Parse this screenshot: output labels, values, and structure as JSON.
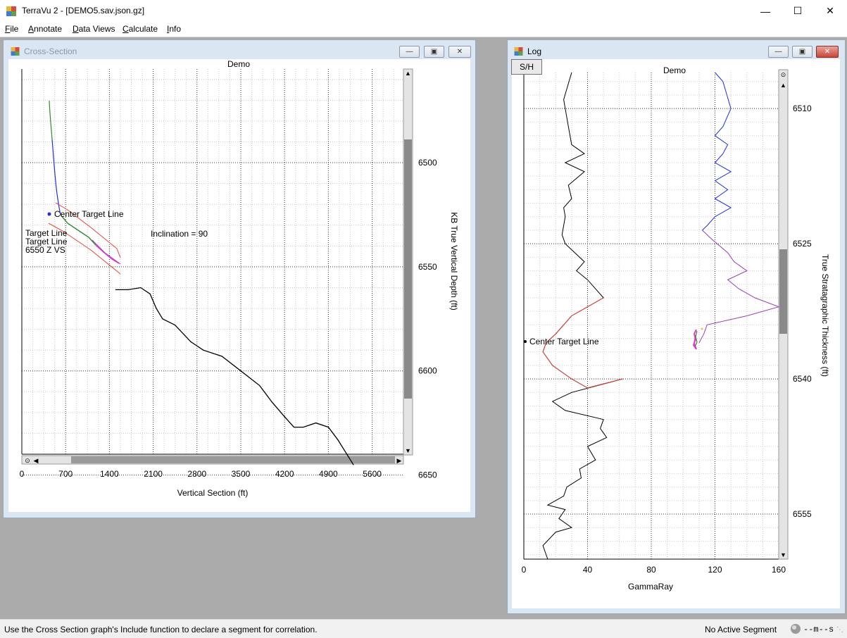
{
  "app": {
    "title": "TerraVu 2 - [DEMO5.sav.json.gz]",
    "window_controls": {
      "minimize": "—",
      "maximize": "☐",
      "close": "✕"
    }
  },
  "menu": {
    "items": [
      {
        "label": "File",
        "accel": "F"
      },
      {
        "label": "Annotate",
        "accel": "A"
      },
      {
        "label": "Data Views",
        "accel": "D"
      },
      {
        "label": "Calculate",
        "accel": "C"
      },
      {
        "label": "Info",
        "accel": "I"
      }
    ]
  },
  "cross_section": {
    "window_title": "Cross-Section",
    "chart_title": "Demo",
    "xlabel": "Vertical Section (ft)",
    "ylabel": "KB True Vertical Depth (ft)",
    "x_ticks": [
      "0",
      "700",
      "1400",
      "2100",
      "2800",
      "3500",
      "4200",
      "4900",
      "5600"
    ],
    "y_ticks": [
      "6500",
      "6550",
      "6600",
      "6650"
    ],
    "annotations": {
      "center_target": "Center Target Line",
      "target_line_1": "Target Line",
      "target_line_2": "Target Line",
      "zvs": "6550 Z VS",
      "inclination": "Inclination = 90"
    }
  },
  "log": {
    "window_title": "Log",
    "sh_button": "S/H",
    "chart_title": "Demo",
    "xlabel": "GammaRay",
    "ylabel": "True Stratagraphic Thickness (ft)",
    "x_ticks": [
      "0",
      "40",
      "80",
      "120",
      "160"
    ],
    "y_ticks": [
      "6510",
      "6525",
      "6540",
      "6555"
    ],
    "annotation": "Center Target Line"
  },
  "status": {
    "message": "Use the Cross Section graph's Include function to declare a segment for correlation.",
    "segment": "No Active Segment",
    "indicator": "--m--s"
  },
  "colors": {
    "well_green": "#2e8b2e",
    "well_blue": "#1f2fe0",
    "target_red": "#e8413a",
    "purple": "#9b3fb5",
    "magenta": "#e53ad0"
  },
  "chart_data": [
    {
      "type": "line",
      "title": "Demo",
      "xlabel": "Vertical Section (ft)",
      "ylabel": "KB True Vertical Depth (ft)",
      "xlim": [
        0,
        6100
      ],
      "ylim": [
        6640,
        6455
      ],
      "series": [
        {
          "name": "",
          "x": [
            1500,
            1700,
            1900,
            2050,
            2150,
            2250,
            2450,
            2700,
            2900,
            3200,
            3500,
            3800,
            4000,
            4200,
            4350,
            4500,
            4700,
            4900,
            5050,
            5300
          ],
          "y": [
            6561,
            6561,
            6560,
            6563,
            6570,
            6575,
            6578,
            6586,
            6590,
            6593,
            6600,
            6607,
            6615,
            6622,
            6627,
            6627,
            6625,
            6627,
            6633,
            6645
          ]
        }
      ]
    },
    {
      "type": "line",
      "title": "Demo",
      "xlabel": "GammaRay",
      "ylabel": "True Stratagraphic Thickness (ft)",
      "xlim": [
        0,
        160
      ],
      "ylim": [
        6506,
        6560
      ],
      "series": [
        {
          "name": "",
          "x": [
            30,
            25,
            28,
            30,
            38,
            26,
            38,
            28,
            30,
            25,
            26,
            24,
            26,
            38,
            33,
            40,
            50,
            30,
            20,
            14,
            12,
            18,
            30,
            40,
            62,
            30,
            18,
            26,
            50,
            48,
            52,
            40,
            45,
            35,
            36,
            27,
            25,
            15,
            26,
            22,
            30,
            20,
            12,
            15
          ],
          "y": [
            6506,
            6509,
            6512,
            6514,
            6515,
            6516,
            6517,
            6518.5,
            6520,
            6521,
            6522,
            6524,
            6525,
            6527,
            6528,
            6529,
            6531,
            6533,
            6535,
            6536,
            6537,
            6538.5,
            6540,
            6541,
            6540,
            6541.5,
            6542.5,
            6543.5,
            6544.5,
            6545.5,
            6546.5,
            6547.5,
            6549,
            6550,
            6551,
            6552,
            6553,
            6554,
            6554.5,
            6555.5,
            6556.5,
            6557,
            6558.5,
            6560
          ]
        },
        {
          "name": "",
          "x": [
            120,
            125,
            130,
            125,
            120,
            128,
            125,
            120,
            130,
            120,
            128,
            120,
            130,
            120,
            115,
            112,
            115,
            118,
            128,
            132,
            140,
            128,
            135,
            145,
            160,
            140,
            115,
            113,
            110
          ],
          "y": [
            6506,
            6507,
            6510,
            6512,
            6513,
            6514,
            6515,
            6516,
            6517,
            6518,
            6519,
            6520,
            6521,
            6522,
            6523,
            6523.5,
            6524,
            6524.5,
            6526,
            6527,
            6528,
            6529,
            6530,
            6531,
            6532,
            6533,
            6534,
            6535,
            6536
          ]
        }
      ]
    }
  ]
}
